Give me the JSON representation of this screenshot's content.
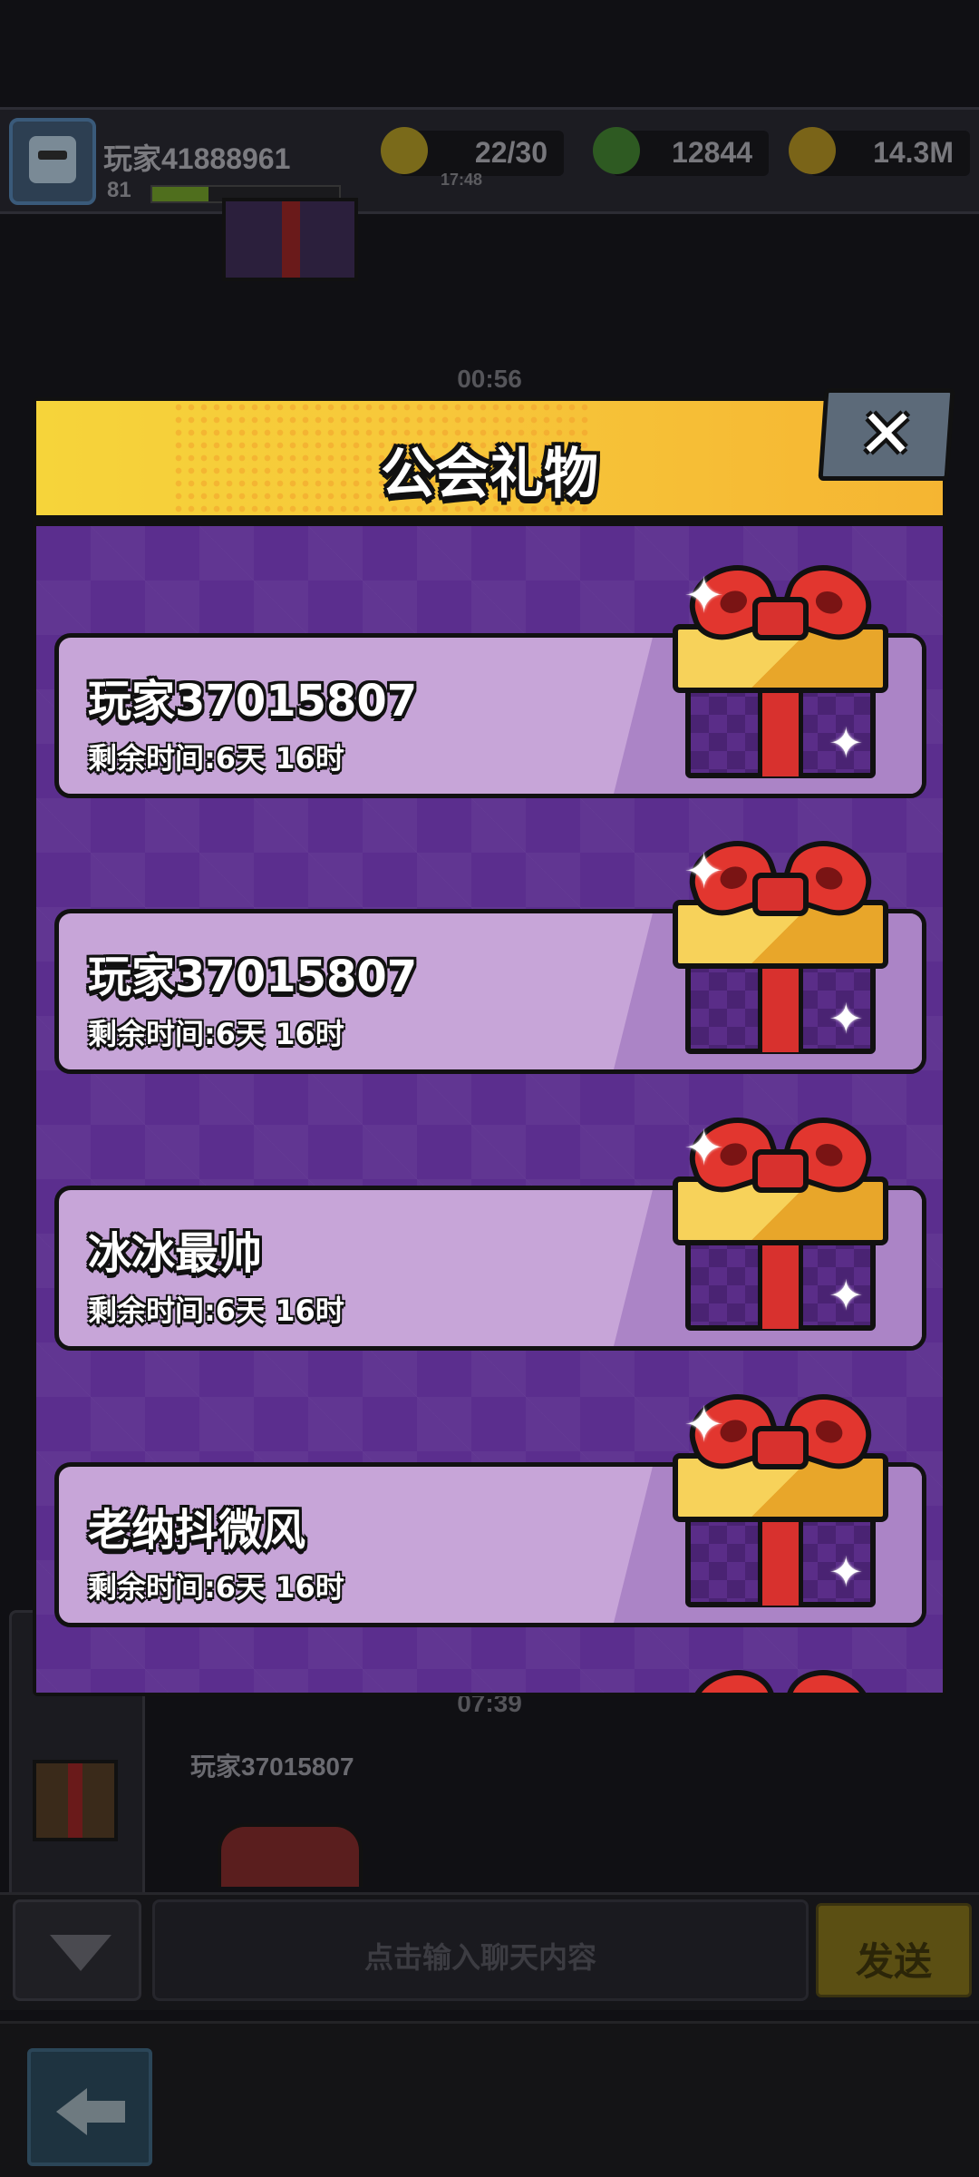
{
  "background": {
    "player_name": "玩家41888961",
    "player_level": "81",
    "xp_progress": 0.3,
    "energy": "22/30",
    "energy_timer": "17:48",
    "gems": "12844",
    "coins": "14.3M",
    "timer_top": "00:56",
    "timer_bottom": "07:39",
    "chat_player_name": "玩家37015807",
    "chat_input_placeholder": "点击输入聊天内容",
    "send_label": "发送"
  },
  "dialog": {
    "title": "公会礼物",
    "close_label": "✕",
    "gifts": [
      {
        "sender": "玩家37015807",
        "remaining": "剩余时间:6天 16时"
      },
      {
        "sender": "玩家37015807",
        "remaining": "剩余时间:6天 16时"
      },
      {
        "sender": "冰冰最帅",
        "remaining": "剩余时间:6天 16时"
      },
      {
        "sender": "老纳抖微风",
        "remaining": "剩余时间:6天 16时"
      }
    ]
  },
  "colors": {
    "header_yellow": "#f7c73a",
    "dialog_purple": "#5b2e8e",
    "card_lilac": "#c7a5d8",
    "ribbon_red": "#d8312e"
  },
  "icons": {
    "close": "close-icon",
    "gift": "gift-box-icon",
    "back": "back-arrow-icon",
    "collapse": "chevron-down-icon"
  }
}
